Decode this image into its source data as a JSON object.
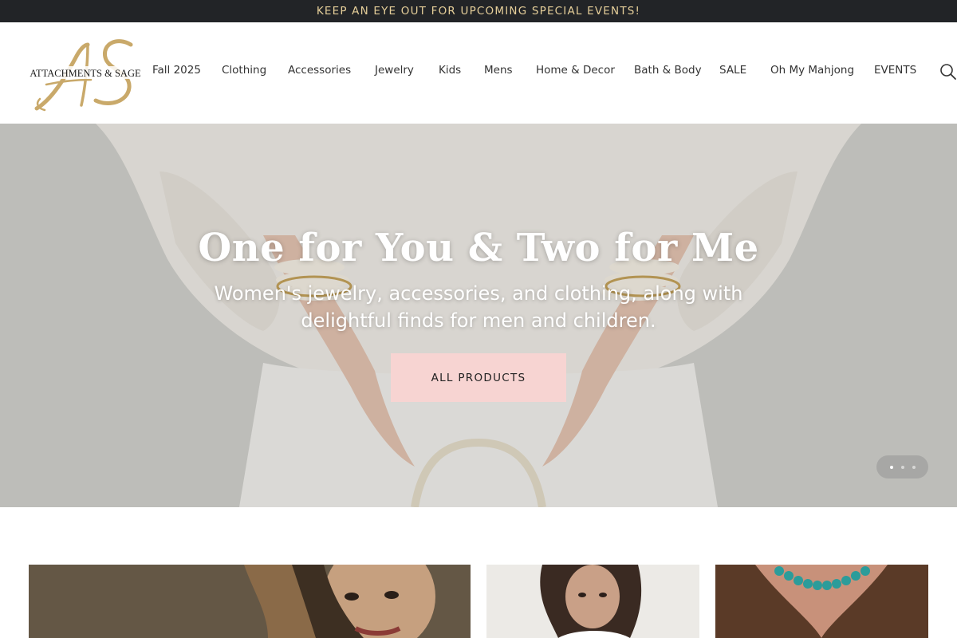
{
  "announcement": {
    "text": "KEEP AN EYE OUT FOR UPCOMING SPECIAL EVENTS!"
  },
  "brand": {
    "name": "ATTACHMENTS & SAGE",
    "monogram": "AS",
    "gold": "#c9a96a"
  },
  "nav": {
    "items": [
      {
        "label": "Fall 2025"
      },
      {
        "label": "Clothing"
      },
      {
        "label": "Accessories"
      },
      {
        "label": "Jewelry"
      },
      {
        "label": "Kids"
      },
      {
        "label": "Mens"
      },
      {
        "label": "Home & Decor"
      },
      {
        "label": "Bath & Body"
      },
      {
        "label": "SALE"
      },
      {
        "label": "Oh My Mahjong"
      },
      {
        "label": "EVENTS"
      }
    ],
    "search_icon": "search-icon"
  },
  "hero": {
    "title": "One for You & Two for Me",
    "subtitle": "Women's jewelry, accessories, and clothing, along with delightful finds for men and children.",
    "cta_label": "ALL PRODUCTS",
    "cta_color": "#f7d4d2",
    "slides": {
      "count": 3,
      "active": 1
    }
  },
  "colors": {
    "announcement_bg": "#222427",
    "announcement_text": "#e6cf9a"
  }
}
